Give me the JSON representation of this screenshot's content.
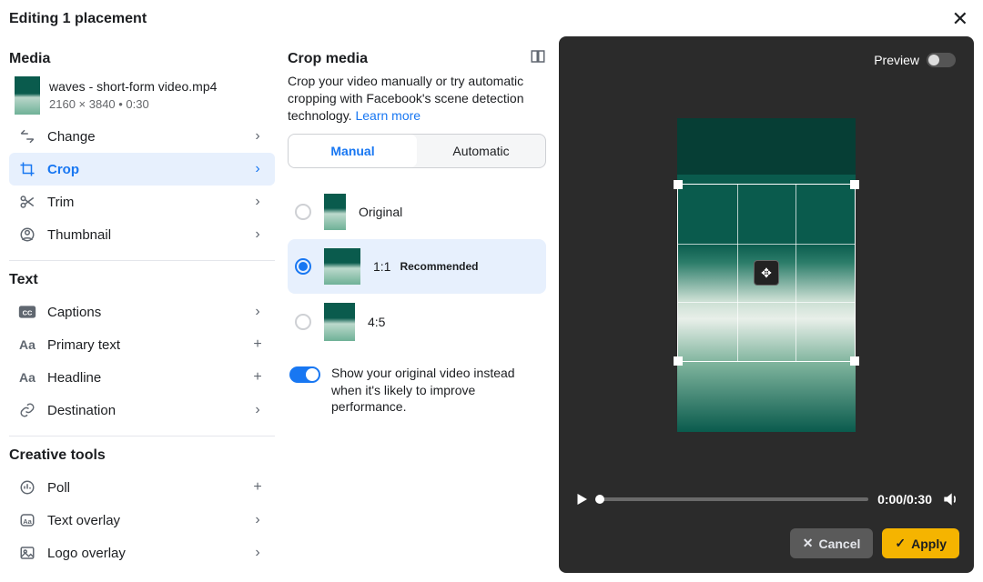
{
  "header": {
    "title": "Editing 1 placement"
  },
  "sidebar": {
    "media_heading": "Media",
    "file": {
      "name": "waves - short-form video.mp4",
      "meta": "2160 × 3840 • 0:30"
    },
    "media_items": {
      "change": "Change",
      "crop": "Crop",
      "trim": "Trim",
      "thumbnail": "Thumbnail"
    },
    "text_heading": "Text",
    "text_items": {
      "captions": "Captions",
      "primary_text": "Primary text",
      "headline": "Headline",
      "destination": "Destination"
    },
    "tools_heading": "Creative tools",
    "tools_items": {
      "poll": "Poll",
      "text_overlay": "Text overlay",
      "logo_overlay": "Logo overlay"
    }
  },
  "crop": {
    "heading": "Crop media",
    "description_a": "Crop your video manually or try automatic cropping with Facebook's scene detection technology. ",
    "learn_more": "Learn more",
    "tabs": {
      "manual": "Manual",
      "automatic": "Automatic"
    },
    "ratios": {
      "original": "Original",
      "one_one": "1:1",
      "recommended": "Recommended",
      "four_five": "4:5"
    },
    "toggle_text": "Show your original video instead when it's likely to improve performance."
  },
  "preview": {
    "label": "Preview",
    "time": "0:00/0:30",
    "cancel": "Cancel",
    "apply": "Apply"
  }
}
